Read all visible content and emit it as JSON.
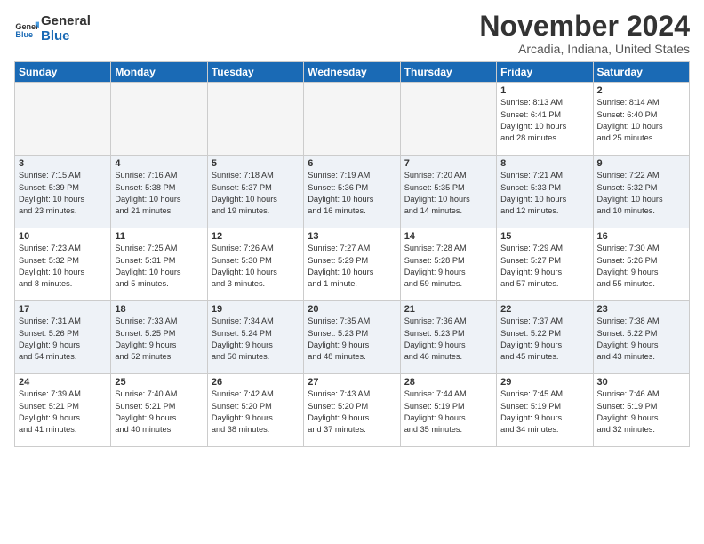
{
  "header": {
    "logo_line1": "General",
    "logo_line2": "Blue",
    "month": "November 2024",
    "location": "Arcadia, Indiana, United States"
  },
  "weekdays": [
    "Sunday",
    "Monday",
    "Tuesday",
    "Wednesday",
    "Thursday",
    "Friday",
    "Saturday"
  ],
  "weeks": [
    [
      {
        "day": "",
        "info": ""
      },
      {
        "day": "",
        "info": ""
      },
      {
        "day": "",
        "info": ""
      },
      {
        "day": "",
        "info": ""
      },
      {
        "day": "",
        "info": ""
      },
      {
        "day": "1",
        "info": "Sunrise: 8:13 AM\nSunset: 6:41 PM\nDaylight: 10 hours\nand 28 minutes."
      },
      {
        "day": "2",
        "info": "Sunrise: 8:14 AM\nSunset: 6:40 PM\nDaylight: 10 hours\nand 25 minutes."
      }
    ],
    [
      {
        "day": "3",
        "info": "Sunrise: 7:15 AM\nSunset: 5:39 PM\nDaylight: 10 hours\nand 23 minutes."
      },
      {
        "day": "4",
        "info": "Sunrise: 7:16 AM\nSunset: 5:38 PM\nDaylight: 10 hours\nand 21 minutes."
      },
      {
        "day": "5",
        "info": "Sunrise: 7:18 AM\nSunset: 5:37 PM\nDaylight: 10 hours\nand 19 minutes."
      },
      {
        "day": "6",
        "info": "Sunrise: 7:19 AM\nSunset: 5:36 PM\nDaylight: 10 hours\nand 16 minutes."
      },
      {
        "day": "7",
        "info": "Sunrise: 7:20 AM\nSunset: 5:35 PM\nDaylight: 10 hours\nand 14 minutes."
      },
      {
        "day": "8",
        "info": "Sunrise: 7:21 AM\nSunset: 5:33 PM\nDaylight: 10 hours\nand 12 minutes."
      },
      {
        "day": "9",
        "info": "Sunrise: 7:22 AM\nSunset: 5:32 PM\nDaylight: 10 hours\nand 10 minutes."
      }
    ],
    [
      {
        "day": "10",
        "info": "Sunrise: 7:23 AM\nSunset: 5:32 PM\nDaylight: 10 hours\nand 8 minutes."
      },
      {
        "day": "11",
        "info": "Sunrise: 7:25 AM\nSunset: 5:31 PM\nDaylight: 10 hours\nand 5 minutes."
      },
      {
        "day": "12",
        "info": "Sunrise: 7:26 AM\nSunset: 5:30 PM\nDaylight: 10 hours\nand 3 minutes."
      },
      {
        "day": "13",
        "info": "Sunrise: 7:27 AM\nSunset: 5:29 PM\nDaylight: 10 hours\nand 1 minute."
      },
      {
        "day": "14",
        "info": "Sunrise: 7:28 AM\nSunset: 5:28 PM\nDaylight: 9 hours\nand 59 minutes."
      },
      {
        "day": "15",
        "info": "Sunrise: 7:29 AM\nSunset: 5:27 PM\nDaylight: 9 hours\nand 57 minutes."
      },
      {
        "day": "16",
        "info": "Sunrise: 7:30 AM\nSunset: 5:26 PM\nDaylight: 9 hours\nand 55 minutes."
      }
    ],
    [
      {
        "day": "17",
        "info": "Sunrise: 7:31 AM\nSunset: 5:26 PM\nDaylight: 9 hours\nand 54 minutes."
      },
      {
        "day": "18",
        "info": "Sunrise: 7:33 AM\nSunset: 5:25 PM\nDaylight: 9 hours\nand 52 minutes."
      },
      {
        "day": "19",
        "info": "Sunrise: 7:34 AM\nSunset: 5:24 PM\nDaylight: 9 hours\nand 50 minutes."
      },
      {
        "day": "20",
        "info": "Sunrise: 7:35 AM\nSunset: 5:23 PM\nDaylight: 9 hours\nand 48 minutes."
      },
      {
        "day": "21",
        "info": "Sunrise: 7:36 AM\nSunset: 5:23 PM\nDaylight: 9 hours\nand 46 minutes."
      },
      {
        "day": "22",
        "info": "Sunrise: 7:37 AM\nSunset: 5:22 PM\nDaylight: 9 hours\nand 45 minutes."
      },
      {
        "day": "23",
        "info": "Sunrise: 7:38 AM\nSunset: 5:22 PM\nDaylight: 9 hours\nand 43 minutes."
      }
    ],
    [
      {
        "day": "24",
        "info": "Sunrise: 7:39 AM\nSunset: 5:21 PM\nDaylight: 9 hours\nand 41 minutes."
      },
      {
        "day": "25",
        "info": "Sunrise: 7:40 AM\nSunset: 5:21 PM\nDaylight: 9 hours\nand 40 minutes."
      },
      {
        "day": "26",
        "info": "Sunrise: 7:42 AM\nSunset: 5:20 PM\nDaylight: 9 hours\nand 38 minutes."
      },
      {
        "day": "27",
        "info": "Sunrise: 7:43 AM\nSunset: 5:20 PM\nDaylight: 9 hours\nand 37 minutes."
      },
      {
        "day": "28",
        "info": "Sunrise: 7:44 AM\nSunset: 5:19 PM\nDaylight: 9 hours\nand 35 minutes."
      },
      {
        "day": "29",
        "info": "Sunrise: 7:45 AM\nSunset: 5:19 PM\nDaylight: 9 hours\nand 34 minutes."
      },
      {
        "day": "30",
        "info": "Sunrise: 7:46 AM\nSunset: 5:19 PM\nDaylight: 9 hours\nand 32 minutes."
      }
    ]
  ]
}
